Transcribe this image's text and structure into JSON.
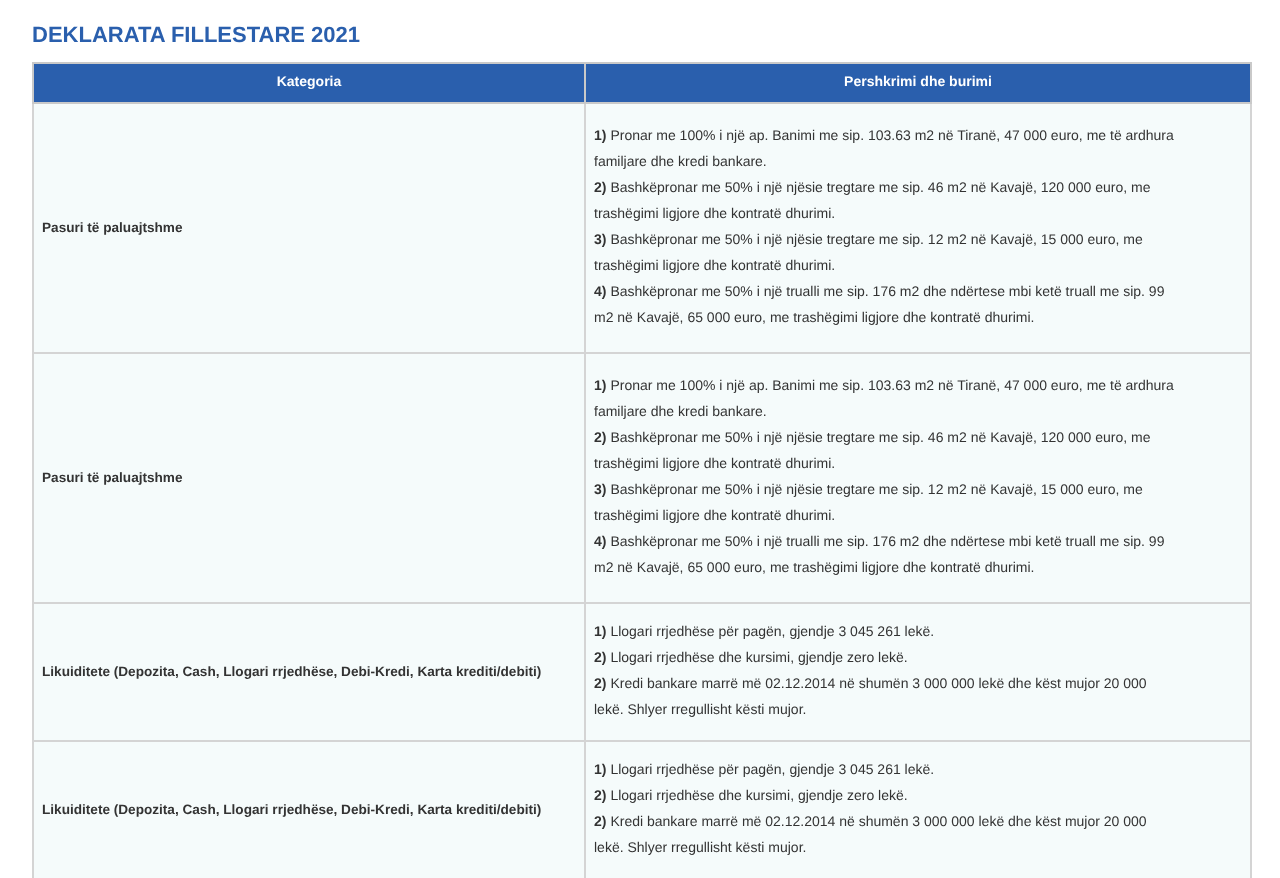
{
  "title": "DEKLARATA FILLESTARE 2021",
  "table": {
    "columns": [
      "Kategoria",
      "Pershkrimi dhe burimi"
    ],
    "rows": [
      {
        "category": "Pasuri të paluajtshme",
        "items": [
          {
            "number": "1)",
            "text": "Pronar me 100% i një ap. Banimi me sip. 103.63 m2 në Tiranë, 47 000 euro, me të ardhura familjare dhe kredi bankare."
          },
          {
            "number": "2)",
            "text": "Bashkëpronar me 50% i një njësie tregtare me sip. 46 m2 në Kavajë, 120 000 euro, me trashëgimi ligjore dhe kontratë dhurimi."
          },
          {
            "number": "3)",
            "text": "Bashkëpronar me 50% i një njësie tregtare me sip. 12 m2 në Kavajë, 15 000 euro, me trashëgimi ligjore dhe kontratë dhurimi."
          },
          {
            "number": "4)",
            "text": "Bashkëpronar me 50% i një trualli me sip. 176 m2 dhe ndërtese mbi ketë truall me sip. 99 m2 në Kavajë, 65 000 euro, me trashëgimi ligjore dhe kontratë dhurimi."
          }
        ]
      },
      {
        "category": "Pasuri të paluajtshme",
        "items": [
          {
            "number": "1)",
            "text": "Pronar me 100% i një ap. Banimi me sip. 103.63 m2 në Tiranë, 47 000 euro, me të ardhura familjare dhe kredi bankare."
          },
          {
            "number": "2)",
            "text": "Bashkëpronar me 50% i një njësie tregtare me sip. 46 m2 në Kavajë, 120 000 euro, me trashëgimi ligjore dhe kontratë dhurimi."
          },
          {
            "number": "3)",
            "text": "Bashkëpronar me 50% i një njësie tregtare me sip. 12 m2 në Kavajë, 15 000 euro, me trashëgimi ligjore dhe kontratë dhurimi."
          },
          {
            "number": "4)",
            "text": "Bashkëpronar me 50% i një trualli me sip. 176 m2 dhe ndërtese mbi ketë truall me sip. 99 m2 në Kavajë, 65 000 euro, me trashëgimi ligjore dhe kontratë dhurimi."
          }
        ]
      },
      {
        "category": "Likuiditete (Depozita, Cash, Llogari rrjedhëse, Debi-Kredi, Karta krediti/debiti)",
        "items": [
          {
            "number": "1)",
            "text": "Llogari rrjedhëse për pagën, gjendje 3 045 261 lekë."
          },
          {
            "number": "2)",
            "text": "Llogari rrjedhëse dhe kursimi, gjendje zero lekë."
          },
          {
            "number": "2)",
            "text": "Kredi bankare marrë më 02.12.2014 në shumën 3 000 000 lekë dhe këst mujor 20 000 lekë. Shlyer rregullisht kësti mujor."
          }
        ]
      },
      {
        "category": "Likuiditete (Depozita, Cash, Llogari rrjedhëse, Debi-Kredi, Karta krediti/debiti)",
        "items": [
          {
            "number": "1)",
            "text": "Llogari rrjedhëse për pagën, gjendje 3 045 261 lekë."
          },
          {
            "number": "2)",
            "text": "Llogari rrjedhëse dhe kursimi, gjendje zero lekë."
          },
          {
            "number": "2)",
            "text": "Kredi bankare marrë më 02.12.2014 në shumën 3 000 000 lekë dhe këst mujor 20 000 lekë. Shlyer rregullisht kësti mujor."
          }
        ]
      }
    ]
  }
}
